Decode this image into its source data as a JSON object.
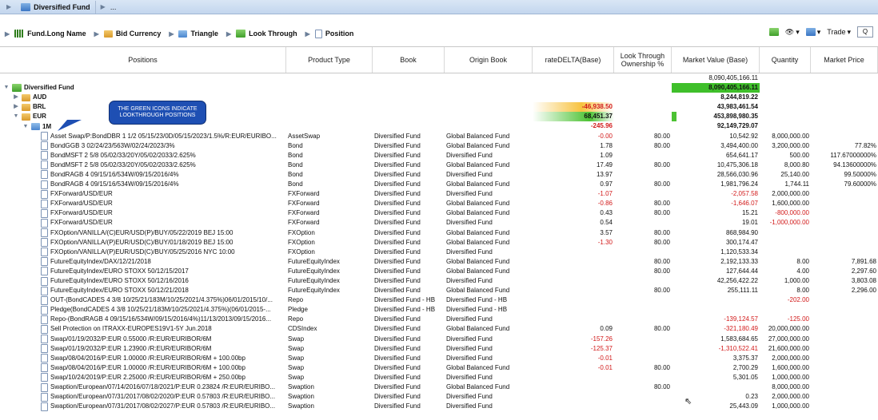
{
  "titlebar": {
    "tab": "Diversified Fund",
    "more": "..."
  },
  "toolbar": {
    "crumbs": [
      "Fund.Long Name",
      "Bid Currency",
      "Triangle",
      "Look Through",
      "Position"
    ],
    "right": {
      "trade_label": "Trade",
      "search_placeholder": "Q"
    }
  },
  "columns": [
    "Positions",
    "Product Type",
    "Book",
    "Origin Book",
    "rateDELTA(Base)",
    "Look Through Ownership %",
    "Market Value (Base)",
    "Quantity",
    "Market Price"
  ],
  "sort_marker": "▲1",
  "callout": "THE GREEN ICONS INDICATE LOOKTHROUGH POSITIONS",
  "total_row": {
    "mv": "8,090,405,166.11"
  },
  "rows": [
    {
      "level": 0,
      "icon": "green",
      "tw": "▼",
      "name": "Diversified Fund",
      "pt": "",
      "book": "",
      "ob": "",
      "rd": "",
      "lt": "",
      "mv": "8,090,405,166.11",
      "qty": "",
      "mp": "",
      "group": true,
      "mvhigh": true
    },
    {
      "level": 1,
      "icon": "folder",
      "tw": "▶",
      "name": "AUD",
      "pt": "",
      "book": "",
      "ob": "",
      "rd": "",
      "lt": "",
      "mv": "8,244,819.22",
      "qty": "",
      "mp": "",
      "group": true
    },
    {
      "level": 1,
      "icon": "folder",
      "tw": "▶",
      "name": "BRL",
      "pt": "",
      "book": "",
      "ob": "",
      "rd": "-46,938.50",
      "lt": "",
      "mv": "43,983,461.54",
      "qty": "",
      "mp": "",
      "group": true,
      "rdneg": true,
      "rdorange": true
    },
    {
      "level": 1,
      "icon": "folder",
      "tw": "▼",
      "name": "EUR",
      "pt": "",
      "book": "",
      "ob": "",
      "rd": "68,451.37",
      "lt": "",
      "mv": "453,898,980.35",
      "qty": "",
      "mp": "",
      "group": true,
      "rdgreen": true,
      "mvtick": true
    },
    {
      "level": 2,
      "icon": "folderblue",
      "tw": "▼",
      "name": "1M",
      "pt": "",
      "book": "",
      "ob": "",
      "rd": "-245.96",
      "lt": "",
      "mv": "92,149,729.07",
      "qty": "",
      "mp": "",
      "group": true,
      "rdneg": true
    },
    {
      "level": 3,
      "icon": "doc",
      "name": "Asset Swap/P:BondDBR 1 1/2 05/15/23/0D/05/15/2023/1.5%/R:EUR/EURIBO...",
      "pt": "AssetSwap",
      "book": "Diversified Fund",
      "ob": "Global Balanced Fund",
      "rd": "-0.00",
      "lt": "80.00",
      "mv": "10,542.92",
      "qty": "8,000,000.00",
      "mp": "",
      "rdneg": true
    },
    {
      "level": 3,
      "icon": "doc",
      "name": "BondGGB 3 02/24/23/563W/02/24/2023/3%",
      "pt": "Bond",
      "book": "Diversified Fund",
      "ob": "Global Balanced Fund",
      "rd": "1.78",
      "lt": "80.00",
      "mv": "3,494,400.00",
      "qty": "3,200,000.00",
      "mp": "77.82%"
    },
    {
      "level": 3,
      "icon": "doc",
      "name": "BondMSFT 2 5/8 05/02/33/20Y/05/02/2033/2.625%",
      "pt": "Bond",
      "book": "Diversified Fund",
      "ob": "Diversified Fund",
      "rd": "1.09",
      "lt": "",
      "mv": "654,641.17",
      "qty": "500.00",
      "mp": "117.67000000%"
    },
    {
      "level": 3,
      "icon": "doc",
      "name": "BondMSFT 2 5/8 05/02/33/20Y/05/02/2033/2.625%",
      "pt": "Bond",
      "book": "Diversified Fund",
      "ob": "Global Balanced Fund",
      "rd": "17.49",
      "lt": "80.00",
      "mv": "10,475,306.18",
      "qty": "8,000.80",
      "mp": "94.13600000%"
    },
    {
      "level": 3,
      "icon": "doc",
      "name": "BondRAGB 4 09/15/16/534W/09/15/2016/4%",
      "pt": "Bond",
      "book": "Diversified Fund",
      "ob": "Diversified Fund",
      "rd": "13.97",
      "lt": "",
      "mv": "28,566,030.96",
      "qty": "25,140.00",
      "mp": "99.50000%"
    },
    {
      "level": 3,
      "icon": "doc",
      "name": "BondRAGB 4 09/15/16/534W/09/15/2016/4%",
      "pt": "Bond",
      "book": "Diversified Fund",
      "ob": "Global Balanced Fund",
      "rd": "0.97",
      "lt": "80.00",
      "mv": "1,981,796.24",
      "qty": "1,744.11",
      "mp": "79.60000%"
    },
    {
      "level": 3,
      "icon": "doc",
      "name": "FXForward/USD/EUR",
      "pt": "FXForward",
      "book": "Diversified Fund",
      "ob": "Diversified Fund",
      "rd": "-1.07",
      "lt": "",
      "mv": "-2,057.58",
      "qty": "2,000,000.00",
      "mp": "",
      "rdneg": true,
      "mvneg": true
    },
    {
      "level": 3,
      "icon": "doc",
      "name": "FXForward/USD/EUR",
      "pt": "FXForward",
      "book": "Diversified Fund",
      "ob": "Global Balanced Fund",
      "rd": "-0.86",
      "lt": "80.00",
      "mv": "-1,646.07",
      "qty": "1,600,000.00",
      "mp": "",
      "rdneg": true,
      "mvneg": true
    },
    {
      "level": 3,
      "icon": "doc",
      "name": "FXForward/USD/EUR",
      "pt": "FXForward",
      "book": "Diversified Fund",
      "ob": "Global Balanced Fund",
      "rd": "0.43",
      "lt": "80.00",
      "mv": "15.21",
      "qty": "-800,000.00",
      "mp": "",
      "qtyneg": true
    },
    {
      "level": 3,
      "icon": "doc",
      "name": "FXForward/USD/EUR",
      "pt": "FXForward",
      "book": "Diversified Fund",
      "ob": "Diversified Fund",
      "rd": "0.54",
      "lt": "",
      "mv": "19.01",
      "qty": "-1,000,000.00",
      "mp": "",
      "qtyneg": true
    },
    {
      "level": 3,
      "icon": "doc",
      "name": "FXOption/VANILLA/(C)EUR/USD(P)/BUY/05/22/2019 BEJ 15:00",
      "pt": "FXOption",
      "book": "Diversified Fund",
      "ob": "Global Balanced Fund",
      "rd": "3.57",
      "lt": "80.00",
      "mv": "868,984.90",
      "qty": "",
      "mp": ""
    },
    {
      "level": 3,
      "icon": "doc",
      "name": "FXOption/VANILLA/(P)EUR/USD(C)/BUY/01/18/2019 BEJ 15:00",
      "pt": "FXOption",
      "book": "Diversified Fund",
      "ob": "Global Balanced Fund",
      "rd": "-1.30",
      "lt": "80.00",
      "mv": "300,174.47",
      "qty": "",
      "mp": "",
      "rdneg": true
    },
    {
      "level": 3,
      "icon": "doc",
      "name": "FXOption/VANILLA/(P)EUR/USD(C)/BUY/05/25/2016 NYC 10:00",
      "pt": "FXOption",
      "book": "Diversified Fund",
      "ob": "Diversified Fund",
      "rd": "",
      "lt": "",
      "mv": "1,120,533.34",
      "qty": "",
      "mp": ""
    },
    {
      "level": 3,
      "icon": "doc",
      "name": "FutureEquityIndex/DAX/12/21/2018",
      "pt": "FutureEquityIndex",
      "book": "Diversified Fund",
      "ob": "Global Balanced Fund",
      "rd": "",
      "lt": "80.00",
      "mv": "2,192,133.33",
      "qty": "8.00",
      "mp": "7,891.68"
    },
    {
      "level": 3,
      "icon": "doc",
      "name": "FutureEquityIndex/EURO STOXX 50/12/15/2017",
      "pt": "FutureEquityIndex",
      "book": "Diversified Fund",
      "ob": "Global Balanced Fund",
      "rd": "",
      "lt": "80.00",
      "mv": "127,644.44",
      "qty": "4.00",
      "mp": "2,297.60"
    },
    {
      "level": 3,
      "icon": "doc",
      "name": "FutureEquityIndex/EURO STOXX 50/12/16/2016",
      "pt": "FutureEquityIndex",
      "book": "Diversified Fund",
      "ob": "Diversified Fund",
      "rd": "",
      "lt": "",
      "mv": "42,256,422.22",
      "qty": "1,000.00",
      "mp": "3,803.08"
    },
    {
      "level": 3,
      "icon": "doc",
      "name": "FutureEquityIndex/EURO STOXX 50/12/21/2018",
      "pt": "FutureEquityIndex",
      "book": "Diversified Fund",
      "ob": "Global Balanced Fund",
      "rd": "",
      "lt": "80.00",
      "mv": "255,111.11",
      "qty": "8.00",
      "mp": "2,296.00"
    },
    {
      "level": 3,
      "icon": "doc",
      "name": "OUT-(BondCADES 4 3/8 10/25/21/183M/10/25/2021/4.375%)06/01/2015/10/...",
      "pt": "Repo",
      "book": "Diversified Fund - HB",
      "ob": "Diversified Fund - HB",
      "rd": "",
      "lt": "",
      "mv": "",
      "qty": "-202.00",
      "mp": "",
      "qtyneg": true
    },
    {
      "level": 3,
      "icon": "doc",
      "name": "Pledge(BondCADES 4 3/8 10/25/21/183M/10/25/2021/4.375%)(06/01/2015-...",
      "pt": "Pledge",
      "book": "Diversified Fund - HB",
      "ob": "Diversified Fund - HB",
      "rd": "",
      "lt": "",
      "mv": "",
      "qty": "",
      "mp": ""
    },
    {
      "level": 3,
      "icon": "doc",
      "name": "Repo-(BondRAGB 4 09/15/16/534W/09/15/2016/4%)11/13/2013/09/15/2016...",
      "pt": "Repo",
      "book": "Diversified Fund",
      "ob": "Diversified Fund",
      "rd": "",
      "lt": "",
      "mv": "-139,124.57",
      "qty": "-125.00",
      "mp": "",
      "mvneg": true,
      "qtyneg": true
    },
    {
      "level": 3,
      "icon": "doc",
      "name": "Sell Protection on ITRAXX-EUROPES19V1-5Y Jun.2018",
      "pt": "CDSIndex",
      "book": "Diversified Fund",
      "ob": "Global Balanced Fund",
      "rd": "0.09",
      "lt": "80.00",
      "mv": "-321,180.49",
      "qty": "20,000,000.00",
      "mp": "",
      "mvneg": true
    },
    {
      "level": 3,
      "icon": "doc",
      "name": "Swap/01/19/2032/P:EUR 0.55000 /R:EUR/EURIBOR/6M",
      "pt": "Swap",
      "book": "Diversified Fund",
      "ob": "Diversified Fund",
      "rd": "-157.26",
      "lt": "",
      "mv": "1,583,684.65",
      "qty": "27,000,000.00",
      "mp": "",
      "rdneg": true
    },
    {
      "level": 3,
      "icon": "doc",
      "name": "Swap/01/19/2032/P:EUR 1.23900 /R:EUR/EURIBOR/6M",
      "pt": "Swap",
      "book": "Diversified Fund",
      "ob": "Diversified Fund",
      "rd": "-125.37",
      "lt": "",
      "mv": "-1,310,522.41",
      "qty": "21,600,000.00",
      "mp": "",
      "rdneg": true,
      "mvneg": true
    },
    {
      "level": 3,
      "icon": "doc",
      "name": "Swap/08/04/2016/P:EUR 1.00000 /R:EUR/EURIBOR/6M + 100.00bp",
      "pt": "Swap",
      "book": "Diversified Fund",
      "ob": "Diversified Fund",
      "rd": "-0.01",
      "lt": "",
      "mv": "3,375.37",
      "qty": "2,000,000.00",
      "mp": "",
      "rdneg": true
    },
    {
      "level": 3,
      "icon": "doc",
      "name": "Swap/08/04/2016/P:EUR 1.00000 /R:EUR/EURIBOR/6M + 100.00bp",
      "pt": "Swap",
      "book": "Diversified Fund",
      "ob": "Global Balanced Fund",
      "rd": "-0.01",
      "lt": "80.00",
      "mv": "2,700.29",
      "qty": "1,600,000.00",
      "mp": "",
      "rdneg": true
    },
    {
      "level": 3,
      "icon": "doc",
      "name": "Swap/10/24/2019/P:EUR 2.25000 /R:EUR/EURIBOR/6M + 250.00bp",
      "pt": "Swap",
      "book": "Diversified Fund",
      "ob": "Diversified Fund",
      "rd": "",
      "lt": "",
      "mv": "5,301.05",
      "qty": "1,000,000.00",
      "mp": ""
    },
    {
      "level": 3,
      "icon": "doc",
      "name": "Swaption/European/07/14/2016/07/18/2021/P:EUR 0.23824 /R:EUR/EURIBO...",
      "pt": "Swaption",
      "book": "Diversified Fund",
      "ob": "Global Balanced Fund",
      "rd": "",
      "lt": "80.00",
      "mv": "",
      "qty": "8,000,000.00",
      "mp": ""
    },
    {
      "level": 3,
      "icon": "doc",
      "name": "Swaption/European/07/31/2017/08/02/2020/P:EUR 0.57803 /R:EUR/EURIBO...",
      "pt": "Swaption",
      "book": "Diversified Fund",
      "ob": "Diversified Fund",
      "rd": "",
      "lt": "",
      "mv": "0.23",
      "qty": "2,000,000.00",
      "mp": ""
    },
    {
      "level": 3,
      "icon": "doc",
      "name": "Swaption/European/07/31/2017/08/02/2027/P:EUR 0.57803 /R:EUR/EURIBO...",
      "pt": "Swaption",
      "book": "Diversified Fund",
      "ob": "Diversified Fund",
      "rd": "",
      "lt": "",
      "mv": "25,443.09",
      "qty": "1,000,000.00",
      "mp": ""
    }
  ]
}
